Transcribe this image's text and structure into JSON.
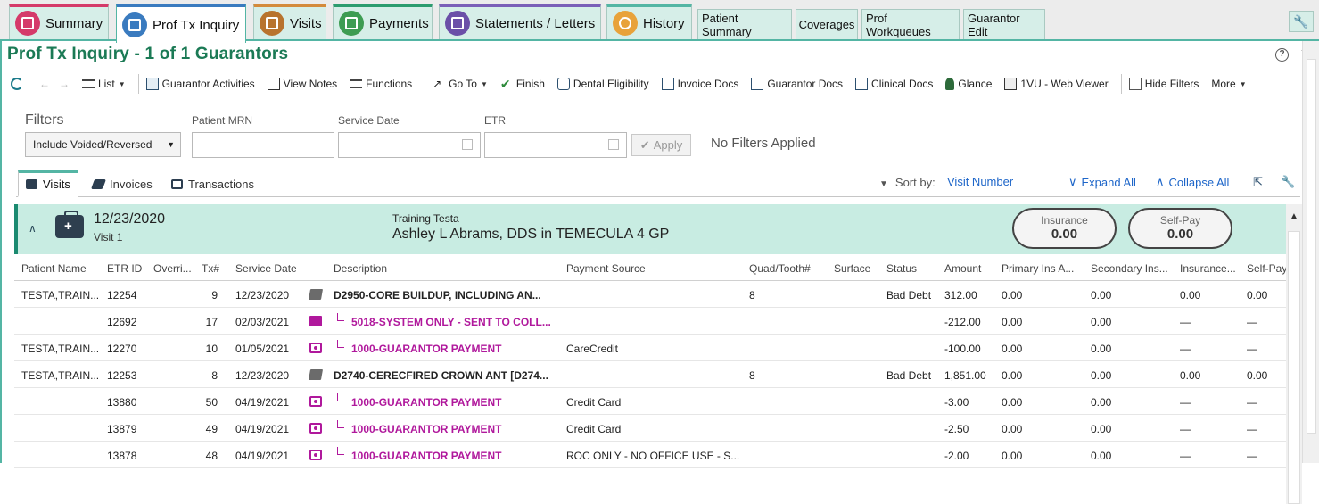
{
  "tabs": [
    {
      "label": "Summary",
      "icon": "summary-icon",
      "color": "#d53a6a",
      "accent": "#d53a6a"
    },
    {
      "label": "Prof Tx Inquiry",
      "icon": "inquiry-icon",
      "color": "#3a7bbf",
      "accent": "#3a7bbf",
      "active": true
    },
    {
      "label": "Visits",
      "icon": "visits-icon",
      "color": "#b8732e",
      "accent": "#d48a3c"
    },
    {
      "label": "Payments",
      "icon": "payments-icon",
      "color": "#3d9c52",
      "accent": "#2d9c6f"
    },
    {
      "label": "Statements / Letters",
      "icon": "statements-icon",
      "color": "#6b4fa8",
      "accent": "#7b5fb8"
    },
    {
      "label": "History",
      "icon": "history-icon",
      "color": "#e8a23a",
      "accent": "#54b5a4"
    }
  ],
  "small_tabs": [
    "Patient Summary",
    "Coverages",
    "Prof Workqueues",
    "Guarantor Edit"
  ],
  "page_title": "Prof Tx Inquiry - 1 of 1 Guarantors",
  "toolbar": {
    "list": "List",
    "guarantor_activities": "Guarantor Activities",
    "view_notes": "View Notes",
    "functions": "Functions",
    "go_to": "Go To",
    "finish": "Finish",
    "dental_eligibility": "Dental Eligibility",
    "invoice_docs": "Invoice Docs",
    "guarantor_docs": "Guarantor Docs",
    "clinical_docs": "Clinical Docs",
    "glance": "Glance",
    "web_viewer": "1VU - Web Viewer",
    "hide_filters": "Hide Filters",
    "more": "More"
  },
  "filters": {
    "title": "Filters",
    "select_value": "Include Voided/Reversed",
    "patient_mrn_label": "Patient MRN",
    "service_date_label": "Service Date",
    "etr_label": "ETR",
    "apply": "Apply",
    "status": "No Filters Applied"
  },
  "subtabs": [
    "Visits",
    "Invoices",
    "Transactions"
  ],
  "sort": {
    "label": "Sort by:",
    "value": "Visit Number",
    "expand_all": "Expand All",
    "collapse_all": "Collapse All"
  },
  "visit": {
    "date": "12/23/2020",
    "number": "Visit 1",
    "patient": "Training Testa",
    "provider": "Ashley L Abrams, DDS in TEMECULA 4 GP",
    "insurance_label": "Insurance",
    "insurance_value": "0.00",
    "selfpay_label": "Self-Pay",
    "selfpay_value": "0.00"
  },
  "columns": [
    "Patient Name",
    "ETR ID",
    "Overri...",
    "Tx#",
    "Service Date",
    "Description",
    "Payment Source",
    "Quad/Tooth#",
    "Surface",
    "Status",
    "Amount",
    "Primary Ins A...",
    "Secondary Ins...",
    "Insurance...",
    "Self-Pay"
  ],
  "rows": [
    {
      "patient": "TESTA,TRAIN...",
      "etr": "12254",
      "tx": "9",
      "date": "12/23/2020",
      "kind": "proc",
      "desc": "D2950-CORE BUILDUP, INCLUDING AN...",
      "source": "",
      "tooth": "8",
      "status": "Bad Debt",
      "amount": "312.00",
      "prim": "0.00",
      "sec": "0.00",
      "ins": "0.00",
      "self": "0.00"
    },
    {
      "patient": "",
      "etr": "12692",
      "tx": "17",
      "date": "02/03/2021",
      "kind": "coll",
      "desc": "5018-SYSTEM ONLY - SENT TO COLL...",
      "source": "",
      "tooth": "",
      "status": "",
      "amount": "-212.00",
      "prim": "0.00",
      "sec": "0.00",
      "ins": "—",
      "self": "—"
    },
    {
      "patient": "TESTA,TRAIN...",
      "etr": "12270",
      "tx": "10",
      "date": "01/05/2021",
      "kind": "pay",
      "desc": "1000-GUARANTOR PAYMENT",
      "source": "CareCredit",
      "tooth": "",
      "status": "",
      "amount": "-100.00",
      "prim": "0.00",
      "sec": "0.00",
      "ins": "—",
      "self": "—"
    },
    {
      "patient": "TESTA,TRAIN...",
      "etr": "12253",
      "tx": "8",
      "date": "12/23/2020",
      "kind": "proc",
      "desc": "D2740-CERECFIRED CROWN ANT [D274...",
      "source": "",
      "tooth": "8",
      "status": "Bad Debt",
      "amount": "1,851.00",
      "prim": "0.00",
      "sec": "0.00",
      "ins": "0.00",
      "self": "0.00"
    },
    {
      "patient": "",
      "etr": "13880",
      "tx": "50",
      "date": "04/19/2021",
      "kind": "pay",
      "desc": "1000-GUARANTOR PAYMENT",
      "source": "Credit Card",
      "tooth": "",
      "status": "",
      "amount": "-3.00",
      "prim": "0.00",
      "sec": "0.00",
      "ins": "—",
      "self": "—"
    },
    {
      "patient": "",
      "etr": "13879",
      "tx": "49",
      "date": "04/19/2021",
      "kind": "pay",
      "desc": "1000-GUARANTOR PAYMENT",
      "source": "Credit Card",
      "tooth": "",
      "status": "",
      "amount": "-2.50",
      "prim": "0.00",
      "sec": "0.00",
      "ins": "—",
      "self": "—"
    },
    {
      "patient": "",
      "etr": "13878",
      "tx": "48",
      "date": "04/19/2021",
      "kind": "pay",
      "desc": "1000-GUARANTOR PAYMENT",
      "source": "ROC ONLY - NO OFFICE USE - S...",
      "tooth": "",
      "status": "",
      "amount": "-2.00",
      "prim": "0.00",
      "sec": "0.00",
      "ins": "—",
      "self": "—"
    }
  ]
}
